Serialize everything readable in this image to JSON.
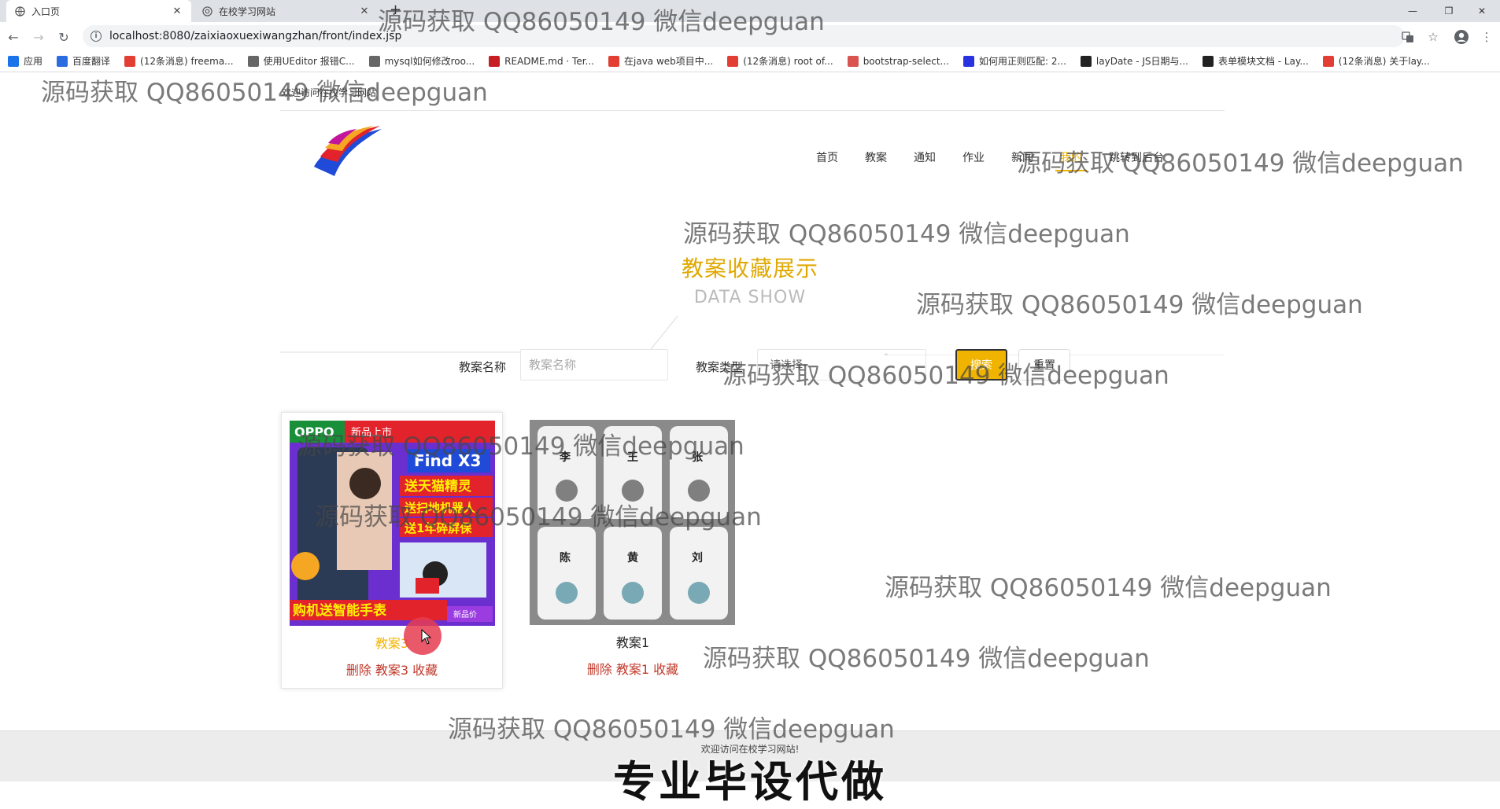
{
  "browser": {
    "tabs": [
      {
        "title": "入口页",
        "active": true
      },
      {
        "title": "在校学习网站",
        "active": false
      }
    ],
    "new_tab": "+",
    "url": "localhost:8080/zaixiaoxuexiwangzhan/front/index.jsp",
    "bookmarks": [
      {
        "label": "应用",
        "icon": "apps-icon",
        "color": "#1a73e8"
      },
      {
        "label": "百度翻译",
        "icon": "baidu-translate-icon",
        "color": "#2b6de0"
      },
      {
        "label": "(12条消息) freema...",
        "icon": "csdn-icon",
        "color": "#e33e33"
      },
      {
        "label": "使用UEditor 报错C...",
        "icon": "link-icon",
        "color": "#666666"
      },
      {
        "label": "mysql如何修改roo...",
        "icon": "link-icon",
        "color": "#666666"
      },
      {
        "label": "README.md · Ter...",
        "icon": "gitee-icon",
        "color": "#c71d23"
      },
      {
        "label": "在java web项目中...",
        "icon": "csdn-icon",
        "color": "#e33e33"
      },
      {
        "label": "(12条消息) root of...",
        "icon": "csdn-icon",
        "color": "#e33e33"
      },
      {
        "label": "bootstrap-select...",
        "icon": "bootstrap-icon",
        "color": "#d9534f"
      },
      {
        "label": "如何用正则匹配: 2...",
        "icon": "baidu-icon",
        "color": "#2932e1"
      },
      {
        "label": "layDate - JS日期与...",
        "icon": "layui-icon",
        "color": "#222222"
      },
      {
        "label": "表单模块文档 - Lay...",
        "icon": "layui-icon",
        "color": "#222222"
      },
      {
        "label": "(12条消息) 关于lay...",
        "icon": "csdn-icon",
        "color": "#e33e33"
      }
    ]
  },
  "site": {
    "welcome_top": "欢迎访问在校学习网站",
    "nav": [
      "首页",
      "教案",
      "通知",
      "作业",
      "新闻",
      "我的",
      "跳转到后台"
    ],
    "nav_active_index": 5,
    "section_title": "教案收藏展示",
    "section_subtitle": "DATA SHOW",
    "search": {
      "name_label": "教案名称",
      "name_placeholder": "教案名称",
      "type_label": "教案类型",
      "type_select": "-请选择-",
      "search_button": "搜索",
      "add_button": "重置"
    },
    "cards": [
      {
        "name": "教案3",
        "actions": "删除 教案3 收藏",
        "highlight": true
      },
      {
        "name": "教案1",
        "actions": "删除 教案1 收藏",
        "highlight": false
      }
    ],
    "footer": "欢迎访问在校学习网站!"
  },
  "overlay": {
    "watermark": "源码获取 QQ86050149 微信deepguan",
    "caption": "专业毕设代做"
  },
  "colors": {
    "accent": "#f0b400",
    "danger_text": "#c0392b"
  }
}
